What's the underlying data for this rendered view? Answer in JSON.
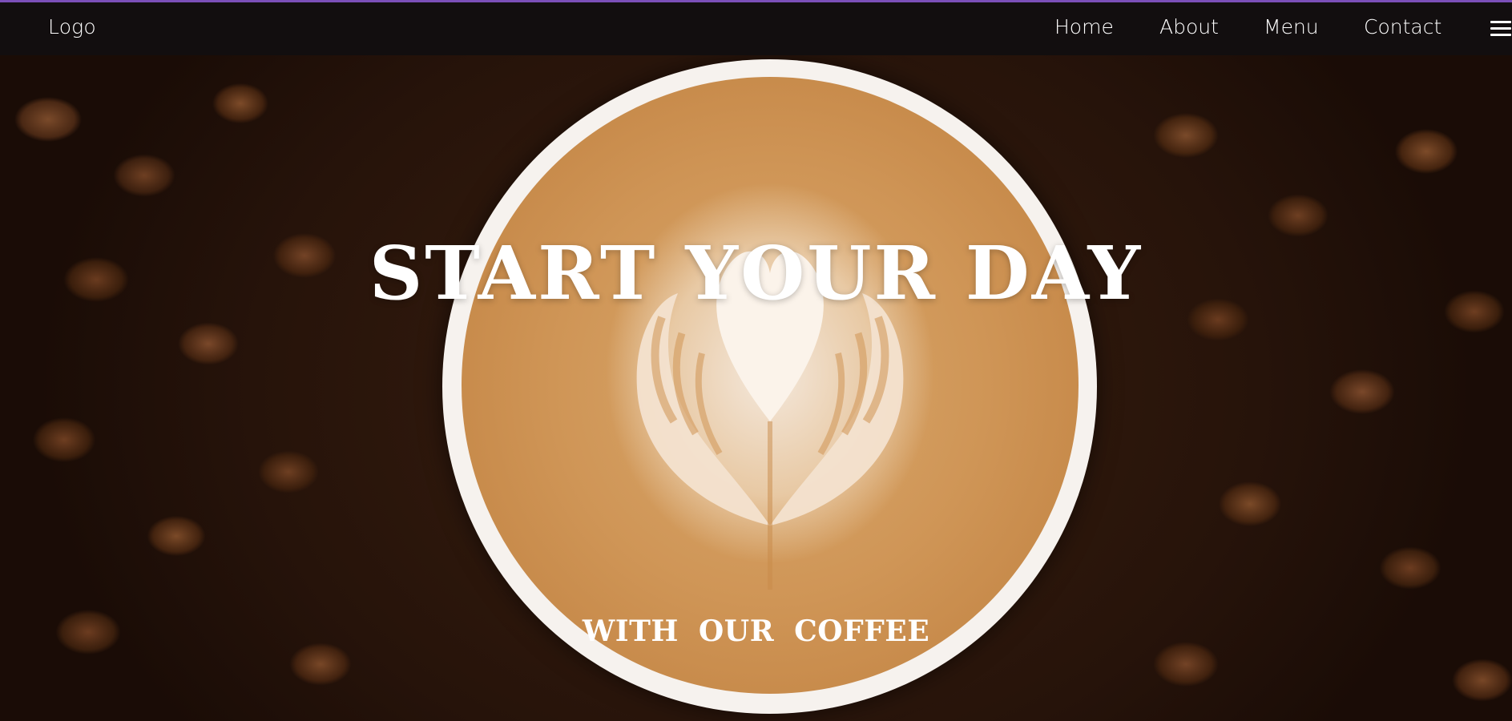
{
  "nav": {
    "logo": "Logo",
    "links": [
      "Home",
      "About",
      "Menu",
      "Contact"
    ],
    "menu_icon": "hamburger-menu-icon",
    "accent_color": "#7b4fb8"
  },
  "hero": {
    "title": "START YOUR DAY",
    "subtitle": "WITH  OUR  COFFEE",
    "background_image": "coffee beans with latte art cup"
  }
}
